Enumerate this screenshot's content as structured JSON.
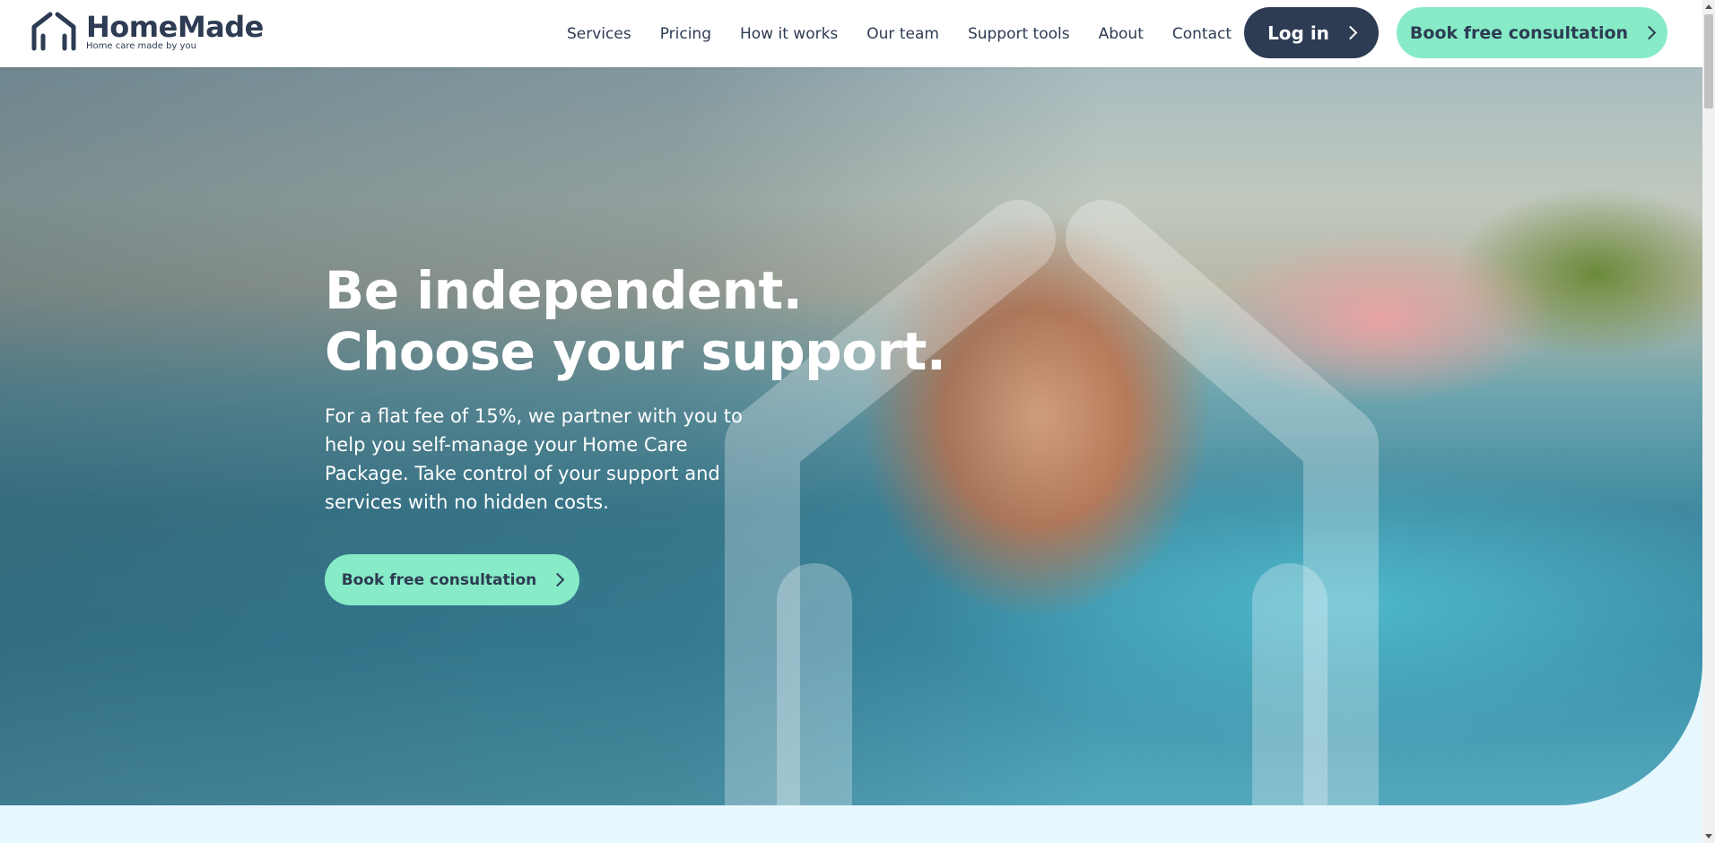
{
  "header": {
    "logo_title": "HomeMade",
    "logo_tagline": "Home care made by you",
    "nav": [
      "Services",
      "Pricing",
      "How it works",
      "Our team",
      "Support tools",
      "About",
      "Contact"
    ],
    "login_label": "Log in",
    "cta_label": "Book free consultation"
  },
  "hero": {
    "title_line1": "Be independent.",
    "title_line2": "Choose your support.",
    "text": "For a flat fee of 15%, we partner with you to help you self-manage your Home Care Package. Take control of your support and services with no hidden costs.",
    "cta_label": "Book free consultation"
  },
  "colors": {
    "navy": "#2d3b53",
    "mint": "#86ebc6",
    "light_band": "#e6f7fd"
  },
  "icons": [
    "house-logo-icon",
    "chevron-right-icon"
  ]
}
